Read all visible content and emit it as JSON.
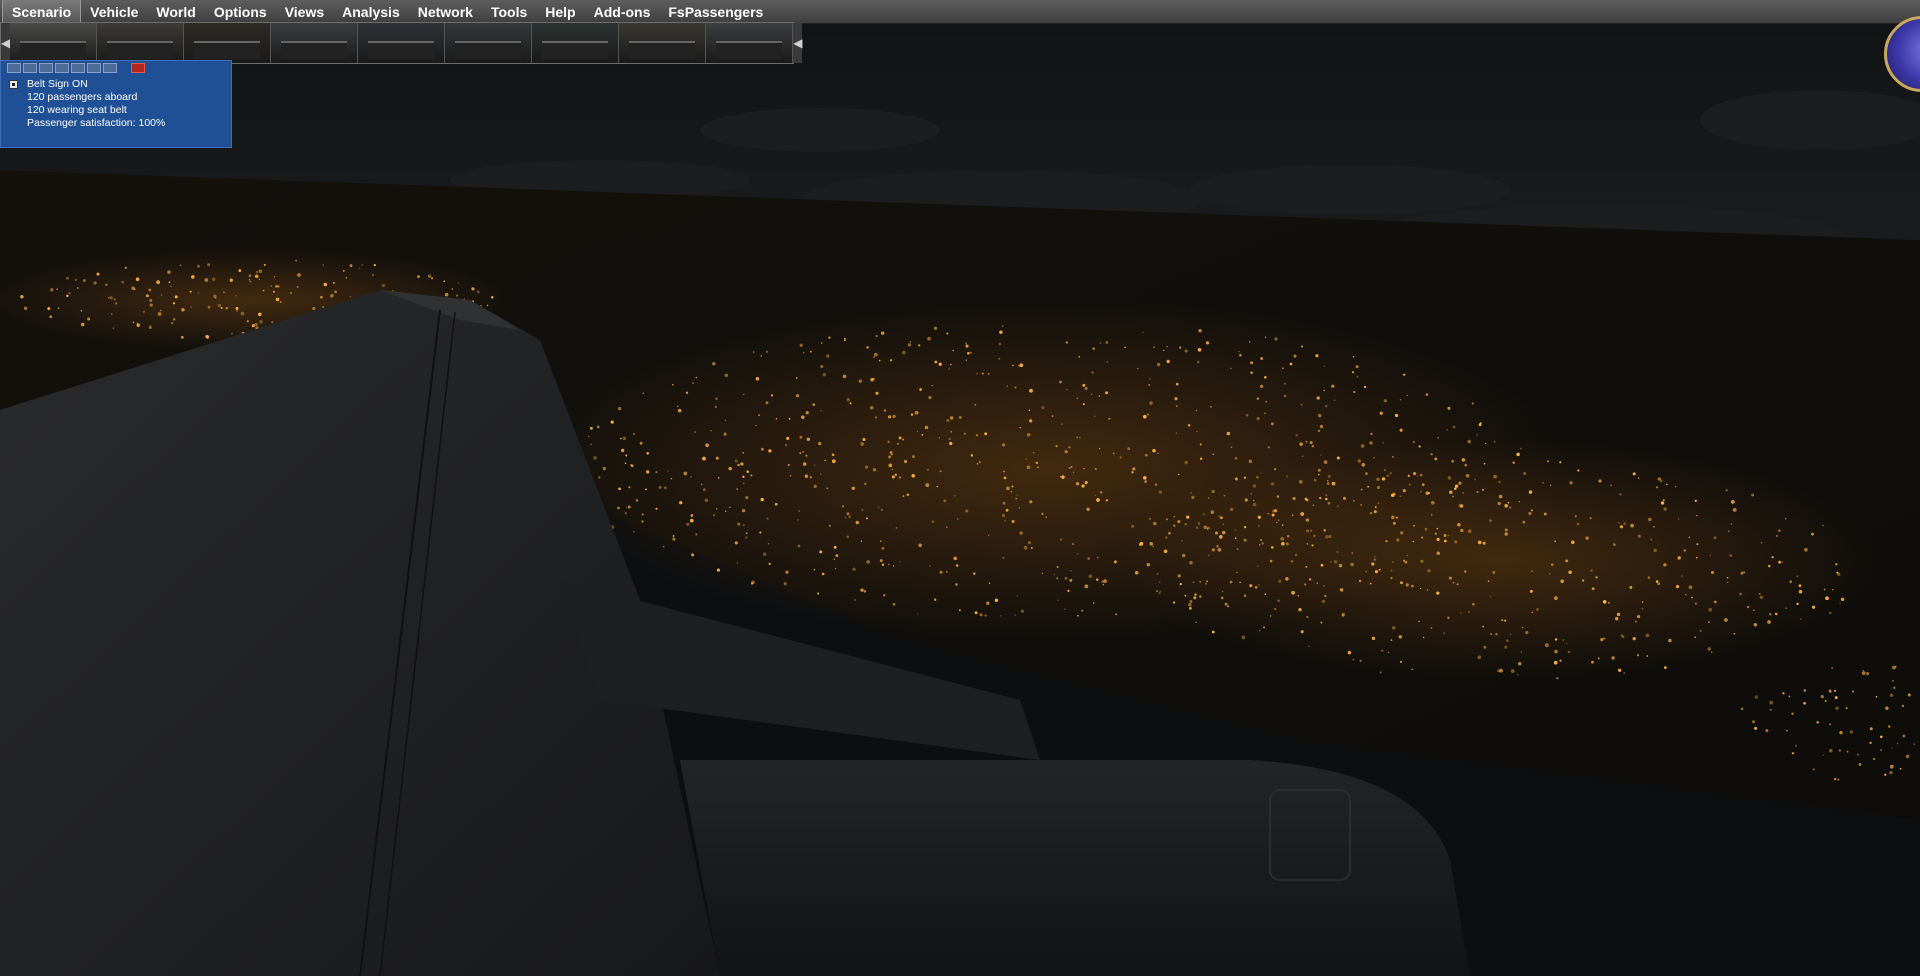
{
  "menubar": {
    "items": [
      {
        "label": "Scenario",
        "active": true
      },
      {
        "label": "Vehicle"
      },
      {
        "label": "World"
      },
      {
        "label": "Options"
      },
      {
        "label": "Views"
      },
      {
        "label": "Analysis"
      },
      {
        "label": "Network"
      },
      {
        "label": "Tools"
      },
      {
        "label": "Help"
      },
      {
        "label": "Add-ons"
      },
      {
        "label": "FsPassengers"
      }
    ]
  },
  "view_strip": {
    "left_arrow": "◀",
    "right_arrow": "◀",
    "thumbnails": [
      "cockpit-view-1",
      "cockpit-view-2",
      "cockpit-view-3",
      "cockpit-view-4",
      "cockpit-view-5",
      "cockpit-view-6",
      "cockpit-view-7",
      "cockpit-view-8",
      "cockpit-view-9"
    ]
  },
  "fspassengers_panel": {
    "belt_sign": "Belt Sign ON",
    "passengers_aboard": "120 passengers aboard",
    "wearing_seat_belt": "120 wearing seat belt",
    "satisfaction": "Passenger satisfaction: 100%"
  },
  "colors": {
    "menubar_bg": "#4a4a4a",
    "panel_bg": "#1f4f94",
    "city_lights": "#ffb347"
  }
}
